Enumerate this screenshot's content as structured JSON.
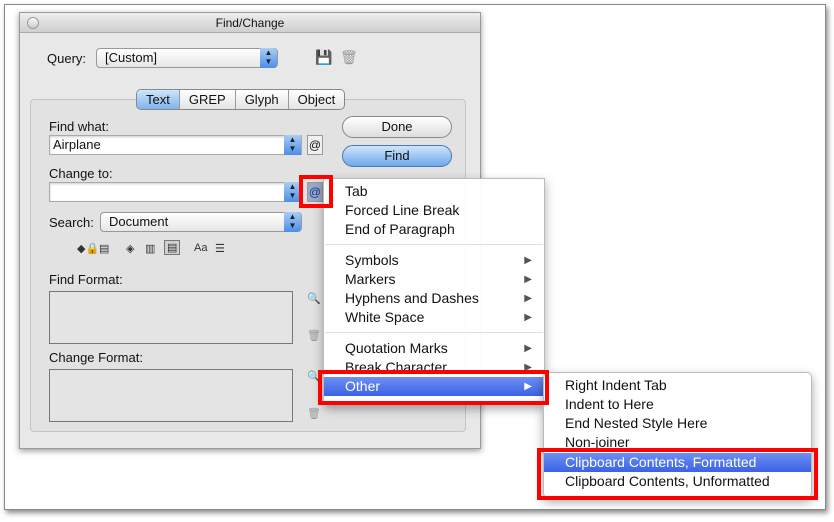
{
  "dialog": {
    "title": "Find/Change",
    "query_label": "Query:",
    "query_value": "[Custom]",
    "tabs": [
      {
        "label": "Text",
        "selected": true
      },
      {
        "label": "GREP",
        "selected": false
      },
      {
        "label": "Glyph",
        "selected": false
      },
      {
        "label": "Object",
        "selected": false
      }
    ],
    "find_what_label": "Find what:",
    "find_what_value": "Airplane",
    "change_to_label": "Change to:",
    "change_to_value": "",
    "search_label": "Search:",
    "search_value": "Document",
    "done_label": "Done",
    "find_label": "Find",
    "find_format_label": "Find Format:",
    "change_format_label": "Change Format:",
    "special_char_glyph": "@",
    "case_glyph": "Aa"
  },
  "special_menu": {
    "groups": [
      [
        {
          "label": "Tab"
        },
        {
          "label": "Forced Line Break"
        },
        {
          "label": "End of Paragraph"
        }
      ],
      [
        {
          "label": "Symbols",
          "submenu": true
        },
        {
          "label": "Markers",
          "submenu": true
        },
        {
          "label": "Hyphens and Dashes",
          "submenu": true
        },
        {
          "label": "White Space",
          "submenu": true
        }
      ],
      [
        {
          "label": "Quotation Marks",
          "submenu": true
        },
        {
          "label": "Break Character",
          "submenu": true
        },
        {
          "label": "Other",
          "submenu": true,
          "highlighted": true
        }
      ]
    ]
  },
  "other_submenu": {
    "items": [
      {
        "label": "Right Indent Tab"
      },
      {
        "label": "Indent to Here"
      },
      {
        "label": "End Nested Style Here"
      },
      {
        "label": "Non-joiner"
      },
      {
        "label": "Clipboard Contents, Formatted",
        "highlighted": true
      },
      {
        "label": "Clipboard Contents, Unformatted"
      }
    ]
  },
  "colors": {
    "highlight": "#3a62e6",
    "annotation": "#ff0000"
  }
}
